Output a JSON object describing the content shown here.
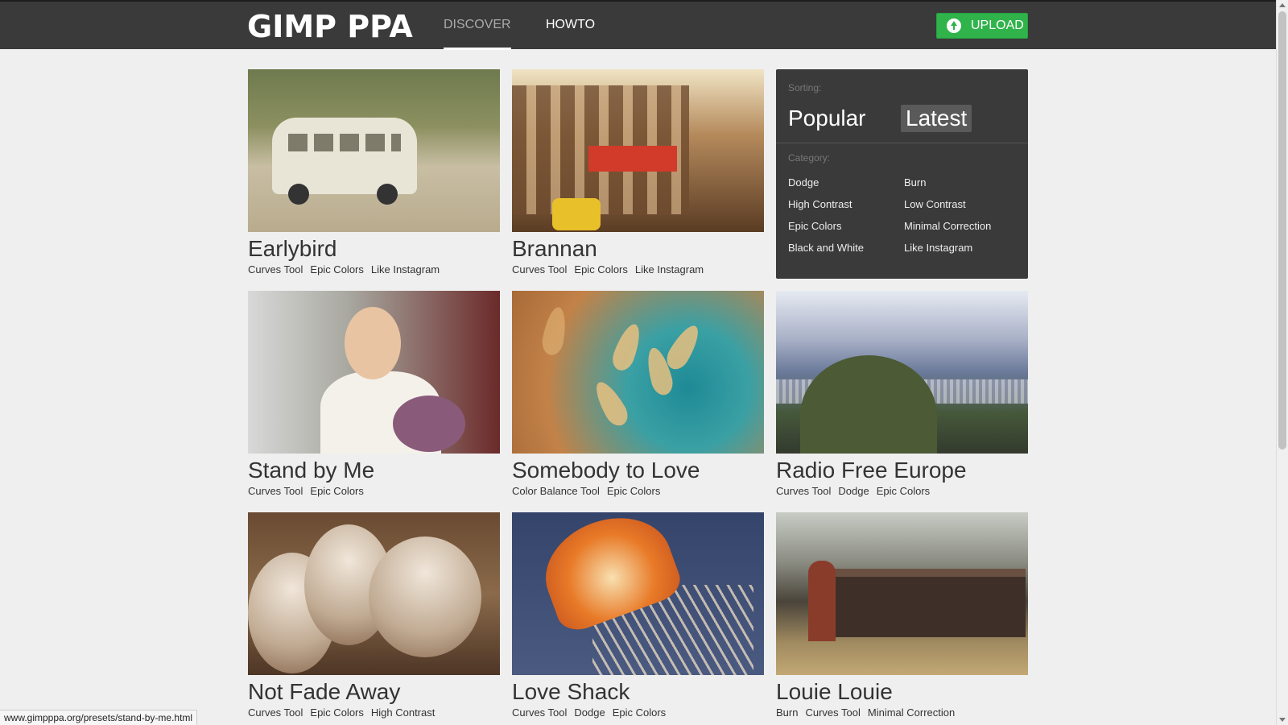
{
  "header": {
    "logo": "GIMP PPA",
    "nav": [
      {
        "label": "DISCOVER",
        "active": true
      },
      {
        "label": "HOWTO",
        "active": false
      }
    ],
    "upload_label": "UPLOAD"
  },
  "presets": [
    {
      "title": "Earlybird",
      "tags": [
        "Curves Tool",
        "Epic Colors",
        "Like Instagram"
      ]
    },
    {
      "title": "Brannan",
      "tags": [
        "Curves Tool",
        "Epic Colors",
        "Like Instagram"
      ]
    },
    {
      "title": "Stand by Me",
      "tags": [
        "Curves Tool",
        "Epic Colors"
      ]
    },
    {
      "title": "Somebody to Love",
      "tags": [
        "Color Balance Tool",
        "Epic Colors"
      ]
    },
    {
      "title": "Radio Free Europe",
      "tags": [
        "Curves Tool",
        "Dodge",
        "Epic Colors"
      ]
    },
    {
      "title": "Not Fade Away",
      "tags": [
        "Curves Tool",
        "Epic Colors",
        "High Contrast"
      ]
    },
    {
      "title": "Love Shack",
      "tags": [
        "Curves Tool",
        "Dodge",
        "Epic Colors"
      ]
    },
    {
      "title": "Louie Louie",
      "tags": [
        "Burn",
        "Curves Tool",
        "Minimal Correction"
      ]
    }
  ],
  "panel": {
    "sorting_label": "Sorting:",
    "sort_options": [
      "Popular",
      "Latest"
    ],
    "sort_selected": "Latest",
    "category_label": "Category:",
    "categories": [
      "Dodge",
      "Burn",
      "High Contrast",
      "Low Contrast",
      "Epic Colors",
      "Minimal Correction",
      "Black and White",
      "Like Instagram"
    ]
  },
  "status_url": "www.gimpppa.org/presets/stand-by-me.html",
  "colors": {
    "header_bg": "#3a3a3a",
    "upload_green": "#2fb34a",
    "page_bg": "#efefef",
    "panel_bg": "#3a3a3a"
  }
}
